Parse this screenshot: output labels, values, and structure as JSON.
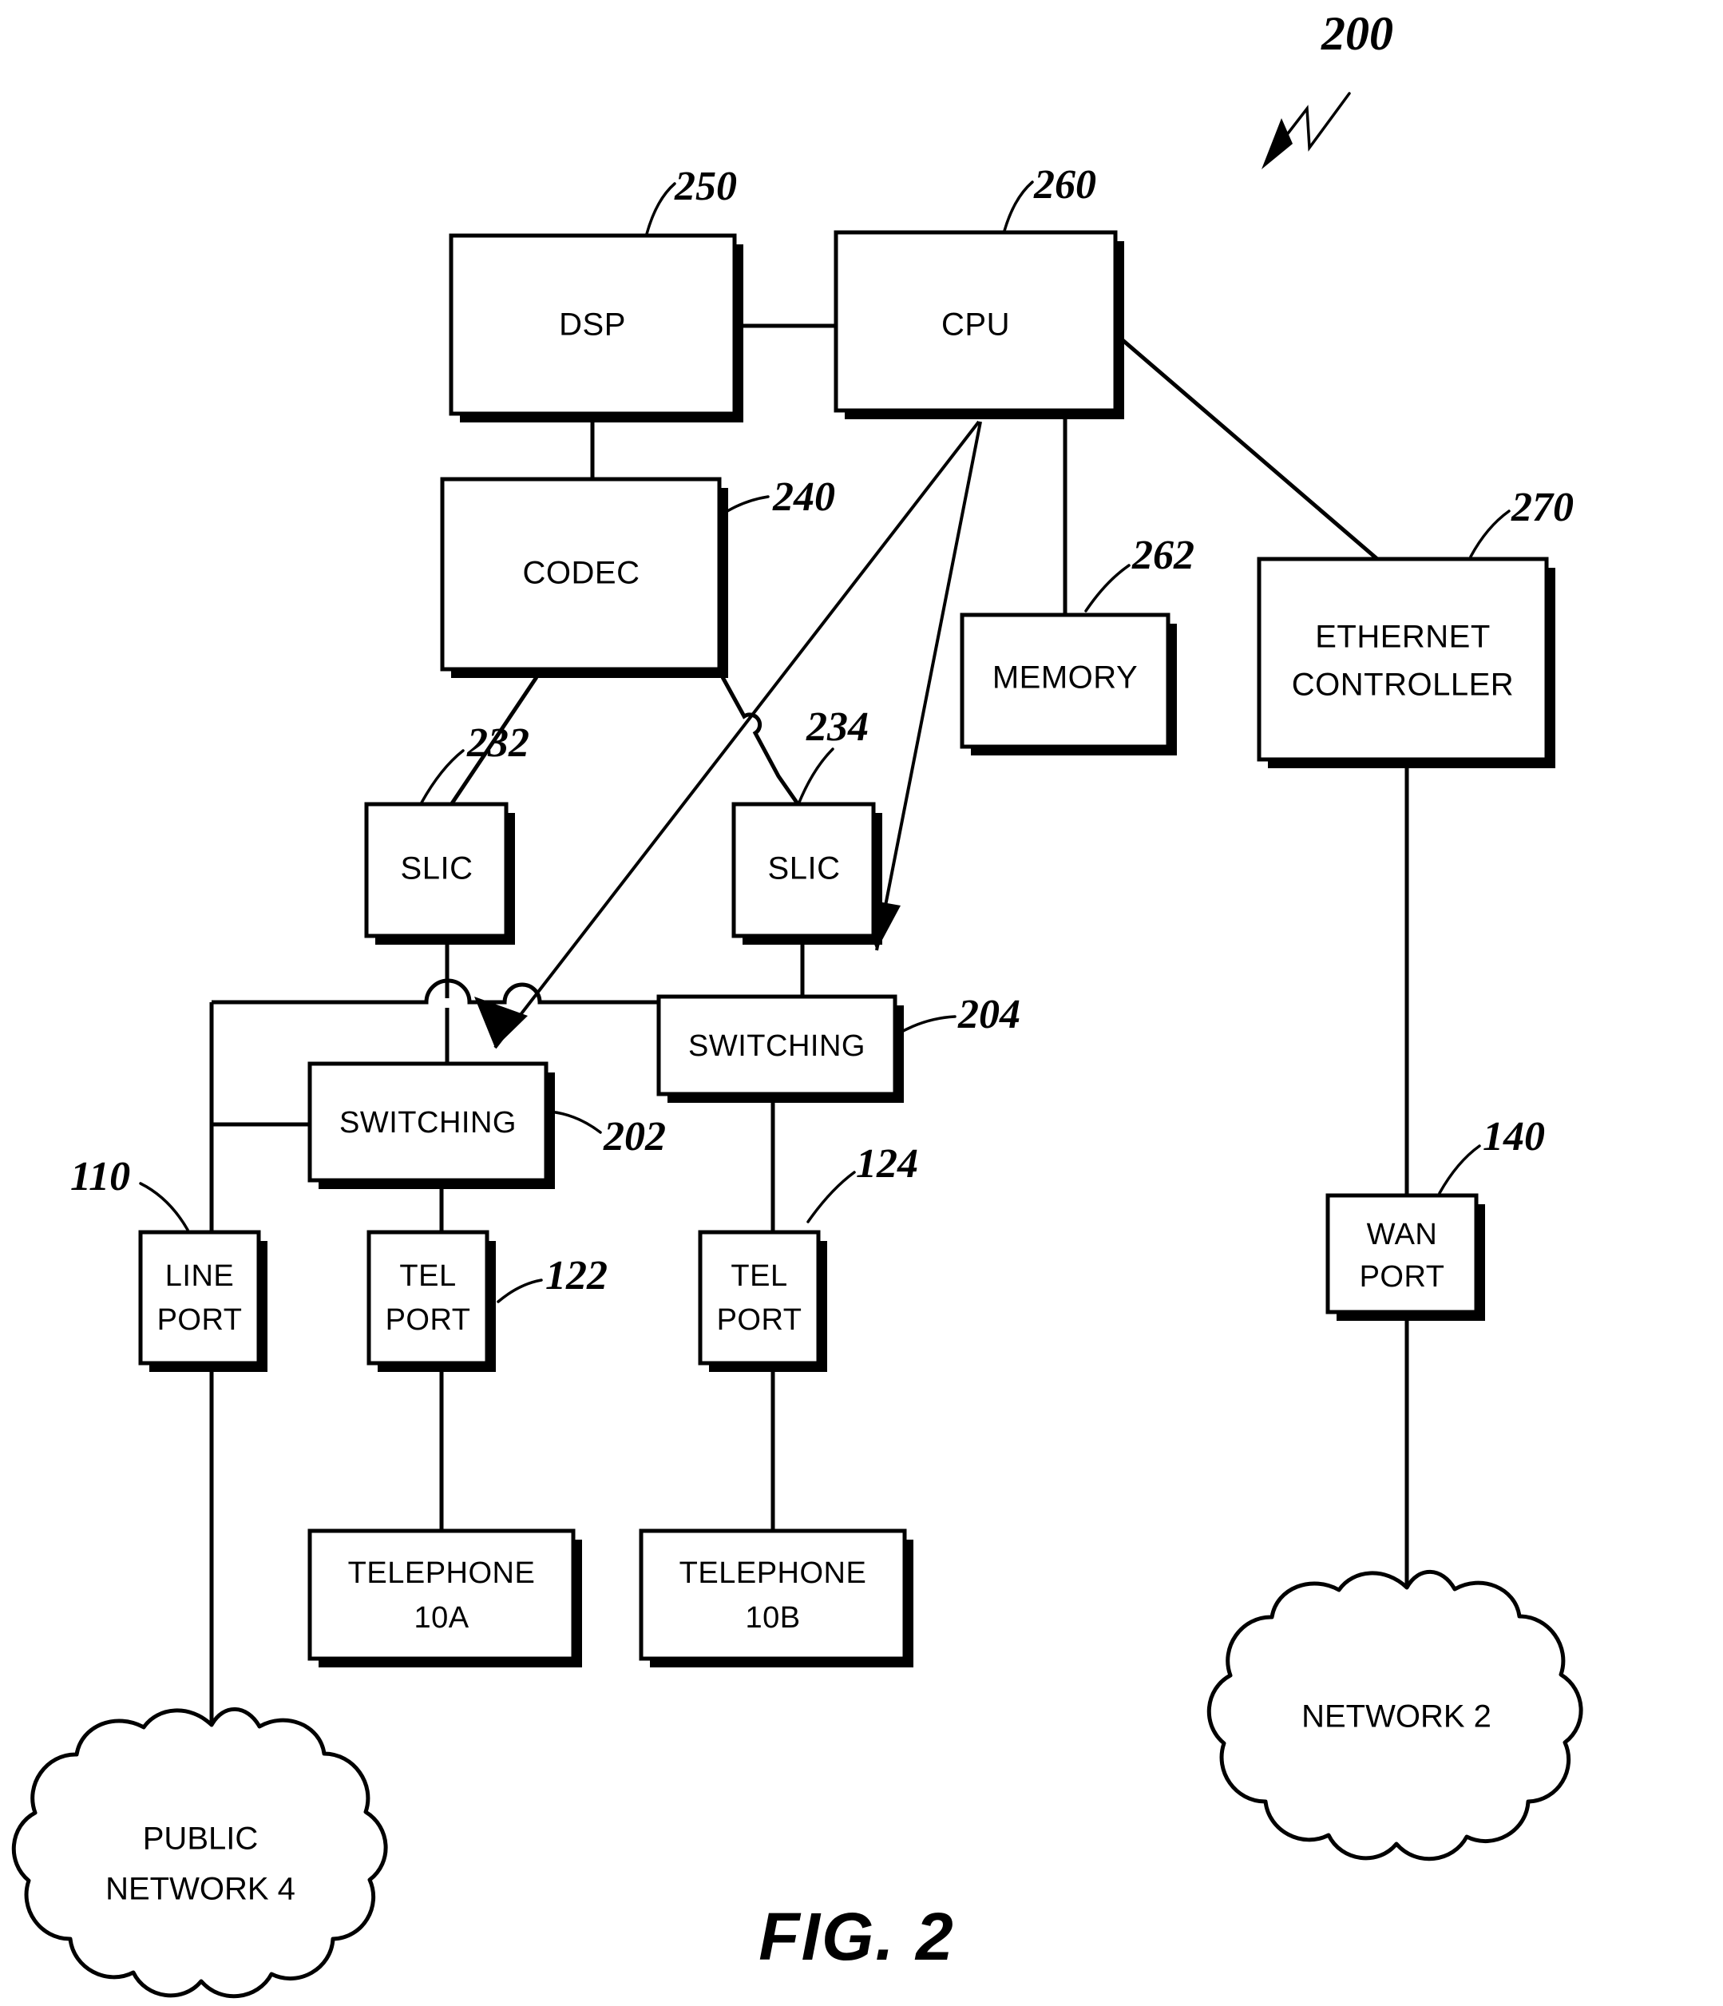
{
  "figure": {
    "caption": "FIG. 2",
    "main_reference": "200"
  },
  "blocks": [
    {
      "id": "dsp",
      "label": "DSP",
      "ref": "250"
    },
    {
      "id": "cpu",
      "label": "CPU",
      "ref": "260"
    },
    {
      "id": "codec",
      "label": "CODEC",
      "ref": "240"
    },
    {
      "id": "memory",
      "label": "MEMORY",
      "ref": "262"
    },
    {
      "id": "ethernet",
      "label_line1": "ETHERNET",
      "label_line2": "CONTROLLER",
      "ref": "270"
    },
    {
      "id": "slic1",
      "label": "SLIC",
      "ref": "232"
    },
    {
      "id": "slic2",
      "label": "SLIC",
      "ref": "234"
    },
    {
      "id": "switching1",
      "label": "SWITCHING",
      "ref": "202"
    },
    {
      "id": "switching2",
      "label": "SWITCHING",
      "ref": "204"
    },
    {
      "id": "lineport",
      "label_line1": "LINE",
      "label_line2": "PORT",
      "ref": "110"
    },
    {
      "id": "telport1",
      "label_line1": "TEL",
      "label_line2": "PORT",
      "ref": "122"
    },
    {
      "id": "telport2",
      "label_line1": "TEL",
      "label_line2": "PORT",
      "ref": "124"
    },
    {
      "id": "wanport",
      "label_line1": "WAN",
      "label_line2": "PORT",
      "ref": "140"
    },
    {
      "id": "telephone1",
      "label_line1": "TELEPHONE",
      "label_line2": "10A"
    },
    {
      "id": "telephone2",
      "label_line1": "TELEPHONE",
      "label_line2": "10B"
    }
  ],
  "clouds": [
    {
      "id": "public_network",
      "label_line1": "PUBLIC",
      "label_line2": "NETWORK 4"
    },
    {
      "id": "network2",
      "label_line1": "NETWORK 2",
      "label_line2": ""
    }
  ],
  "colors": {
    "ink": "#000000",
    "paper": "#ffffff"
  }
}
